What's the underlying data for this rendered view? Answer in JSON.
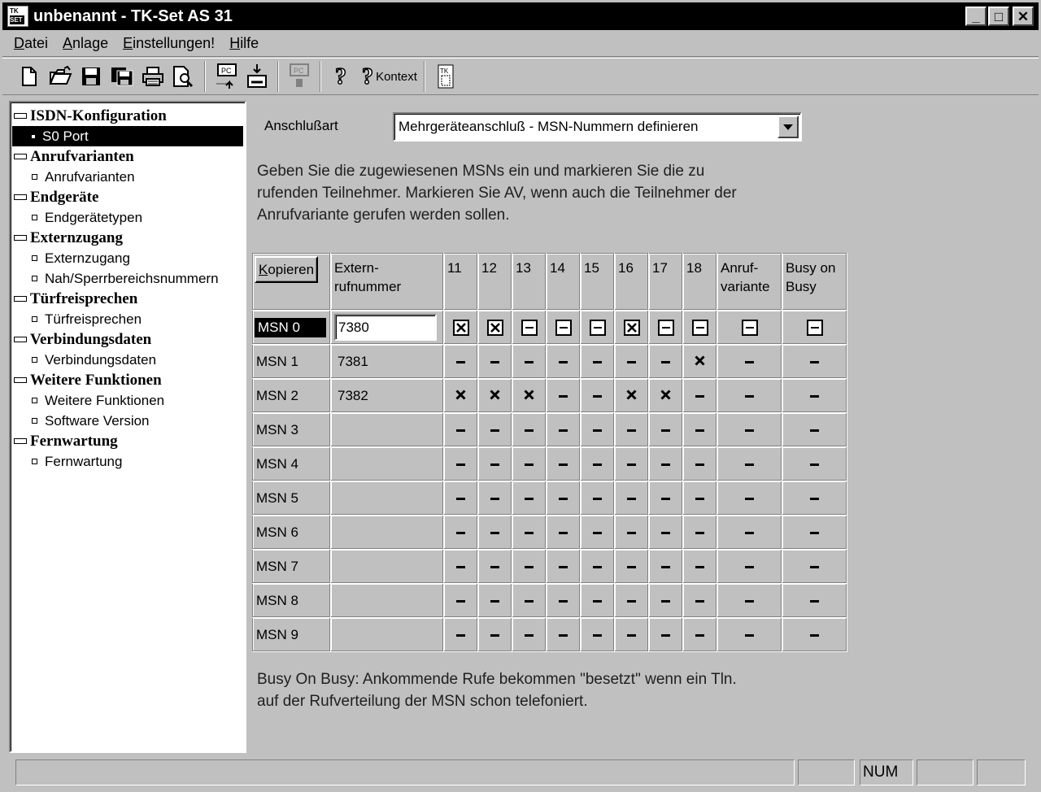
{
  "window": {
    "icon_top": "TK",
    "icon_bottom": "SET",
    "title": "unbenannt - TK-Set AS 31",
    "min_label": "_",
    "max_label": "□",
    "close_label": "✕"
  },
  "menu": {
    "items": [
      {
        "accel": "D",
        "rest": "atei"
      },
      {
        "accel": "A",
        "rest": "nlage"
      },
      {
        "accel": "E",
        "rest": "instellungen!"
      },
      {
        "accel": "H",
        "rest": "ilfe"
      }
    ]
  },
  "toolbar": {
    "context_label": "Kontext",
    "icons": [
      "new-document-icon",
      "open-folder-icon",
      "save-icon",
      "save-all-icon",
      "print-icon",
      "print-preview-icon",
      "pc-upload-icon",
      "phone-download-icon",
      "pc-disabled-icon",
      "help-icon",
      "context-help-icon",
      "about-icon"
    ]
  },
  "tree": {
    "groups": [
      {
        "label": "ISDN-Konfiguration",
        "items": [
          "S0 Port"
        ]
      },
      {
        "label": "Anrufvarianten",
        "items": [
          "Anrufvarianten"
        ]
      },
      {
        "label": "Endgeräte",
        "items": [
          "Endgerätetypen"
        ]
      },
      {
        "label": "Externzugang",
        "items": [
          "Externzugang",
          "Nah/Sperrbereichsnummern"
        ]
      },
      {
        "label": "Türfreisprechen",
        "items": [
          "Türfreisprechen"
        ]
      },
      {
        "label": "Verbindungsdaten",
        "items": [
          "Verbindungsdaten"
        ]
      },
      {
        "label": "Weitere Funktionen",
        "items": [
          "Weitere Funktionen",
          "Software Version"
        ]
      },
      {
        "label": "Fernwartung",
        "items": [
          "Fernwartung"
        ]
      }
    ],
    "selected": "S0 Port"
  },
  "main": {
    "anschluss_label": "Anschlußart",
    "anschluss_value": "Mehrgeräteanschluß - MSN-Nummern definieren",
    "intro_lines": [
      "Geben Sie die zugewiesenen MSNs ein und markieren Sie die zu",
      "rufenden Teilnehmer. Markieren Sie AV, wenn auch die Teilnehmer der",
      "Anrufvariante gerufen werden sollen."
    ],
    "kopieren_accel": "K",
    "kopieren_rest": "opieren",
    "header": {
      "ext_line1": "Extern-",
      "ext_line2": "rufnummer",
      "participants": [
        "11",
        "12",
        "13",
        "14",
        "15",
        "16",
        "17",
        "18"
      ],
      "av_line1": "Anruf-",
      "av_line2": "variante",
      "busy_line1": "Busy on",
      "busy_line2": "Busy"
    },
    "rows": [
      {
        "msn": "MSN 0",
        "ext": "7380",
        "tn": [
          1,
          1,
          0,
          0,
          0,
          1,
          0,
          0
        ],
        "av": 0,
        "busy": 0,
        "active": true
      },
      {
        "msn": "MSN 1",
        "ext": "7381",
        "tn": [
          0,
          0,
          0,
          0,
          0,
          0,
          0,
          1
        ],
        "av": 0,
        "busy": 0
      },
      {
        "msn": "MSN 2",
        "ext": "7382",
        "tn": [
          1,
          1,
          1,
          0,
          0,
          1,
          1,
          0
        ],
        "av": 0,
        "busy": 0
      },
      {
        "msn": "MSN 3",
        "ext": "",
        "tn": [
          0,
          0,
          0,
          0,
          0,
          0,
          0,
          0
        ],
        "av": 0,
        "busy": 0
      },
      {
        "msn": "MSN 4",
        "ext": "",
        "tn": [
          0,
          0,
          0,
          0,
          0,
          0,
          0,
          0
        ],
        "av": 0,
        "busy": 0
      },
      {
        "msn": "MSN 5",
        "ext": "",
        "tn": [
          0,
          0,
          0,
          0,
          0,
          0,
          0,
          0
        ],
        "av": 0,
        "busy": 0
      },
      {
        "msn": "MSN 6",
        "ext": "",
        "tn": [
          0,
          0,
          0,
          0,
          0,
          0,
          0,
          0
        ],
        "av": 0,
        "busy": 0
      },
      {
        "msn": "MSN 7",
        "ext": "",
        "tn": [
          0,
          0,
          0,
          0,
          0,
          0,
          0,
          0
        ],
        "av": 0,
        "busy": 0
      },
      {
        "msn": "MSN 8",
        "ext": "",
        "tn": [
          0,
          0,
          0,
          0,
          0,
          0,
          0,
          0
        ],
        "av": 0,
        "busy": 0
      },
      {
        "msn": "MSN 9",
        "ext": "",
        "tn": [
          0,
          0,
          0,
          0,
          0,
          0,
          0,
          0
        ],
        "av": 0,
        "busy": 0
      }
    ],
    "note_lines": [
      "Busy On Busy: Ankommende Rufe bekommen \"besetzt\" wenn ein Tln.",
      "auf der Rufverteilung der MSN schon telefoniert."
    ]
  },
  "status": {
    "num": "NUM"
  }
}
